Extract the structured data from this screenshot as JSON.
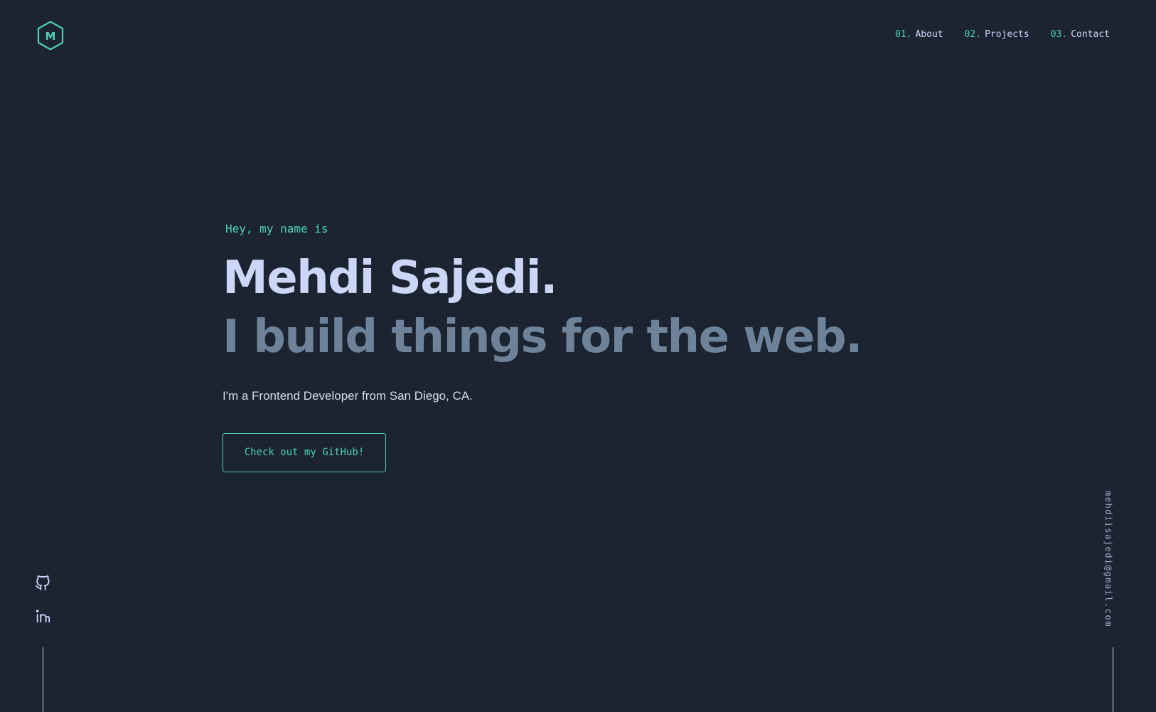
{
  "logo": {
    "letter": "M",
    "icon": "hexagon-m-logo"
  },
  "nav": {
    "items": [
      {
        "num": "01.",
        "label": "About"
      },
      {
        "num": "02.",
        "label": "Projects"
      },
      {
        "num": "03.",
        "label": "Contact"
      }
    ]
  },
  "hero": {
    "greeting": "Hey, my name is",
    "name": "Mehdi Sajedi.",
    "tagline": "I build things for the web.",
    "description": "I'm a Frontend Developer from San Diego, CA.",
    "cta_label": "Check out my GitHub!"
  },
  "socials": [
    {
      "icon": "github-icon"
    },
    {
      "icon": "linkedin-icon"
    }
  ],
  "email": "mehdiisajedi@gmail.com",
  "colors": {
    "background": "#1b2430",
    "accent": "#4fd1b2",
    "heading": "#ccd6f6",
    "subheading": "#6e839a"
  }
}
